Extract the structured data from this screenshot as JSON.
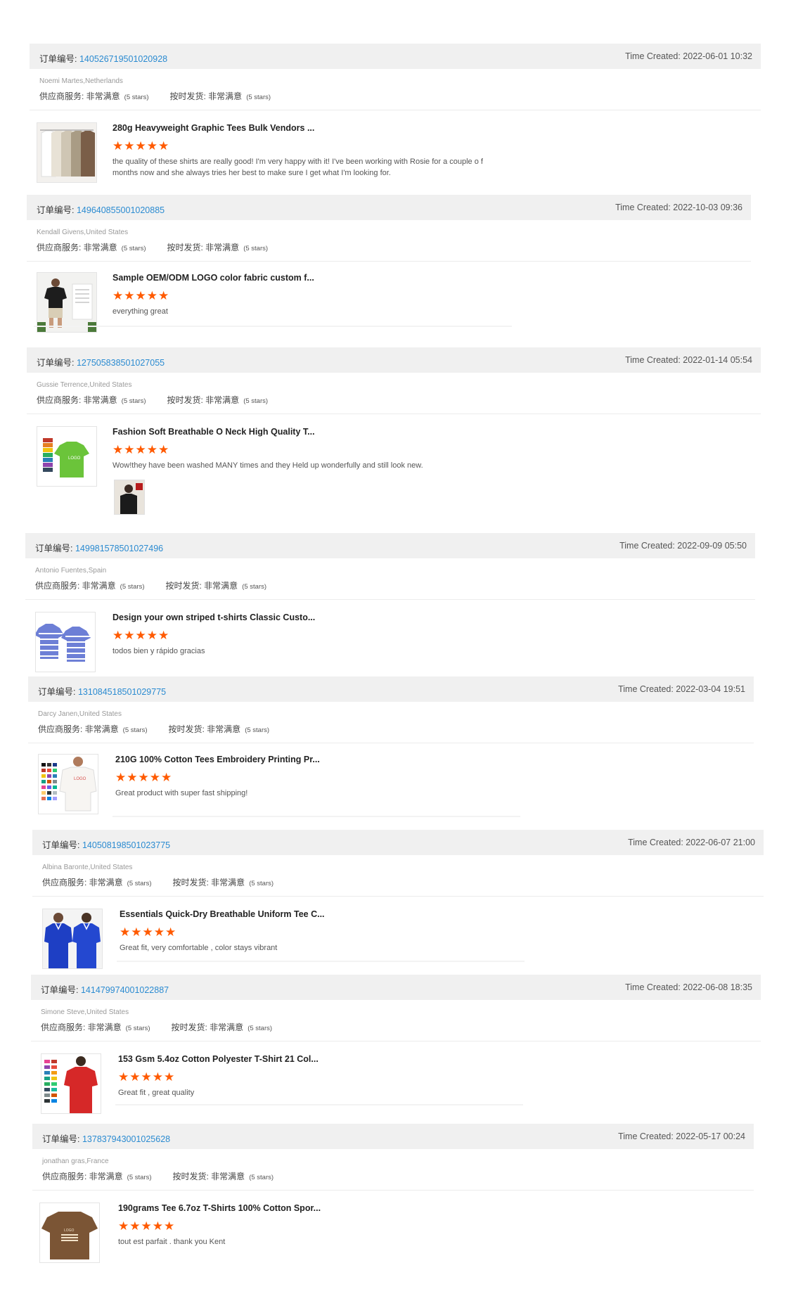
{
  "reviews": [
    {
      "order_label": "订单编号:",
      "order_id": "140526719501020928",
      "time": "Time Created: 2022-06-01 10:32",
      "buyer": "Noemi Martes,Netherlands",
      "supplier_label": "供应商服务: 非常满意",
      "supplier_stars": "(5 stars)",
      "ship_label": "按时发货: 非常满意",
      "ship_stars": "(5 stars)",
      "product": "280g Heavyweight Graphic Tees Bulk Vendors ...",
      "rating": "★★★★★",
      "comment": "the quality of these shirts are really good! I'm very happy with it! I've been working with Rosie for a couple o f months now and she always tries her best to make sure I get what I'm looking for."
    },
    {
      "order_label": "订单编号:",
      "order_id": "149640855001020885",
      "time": "Time Created: 2022-10-03 09:36",
      "buyer": "Kendall Givens,United States",
      "supplier_label": "供应商服务: 非常满意",
      "supplier_stars": "(5 stars)",
      "ship_label": "按时发货: 非常满意",
      "ship_stars": "(5 stars)",
      "product": "Sample OEM/ODM LOGO color fabric custom f...",
      "rating": "★★★★★",
      "comment": "everything great"
    },
    {
      "order_label": "订单编号:",
      "order_id": "127505838501027055",
      "time": "Time Created: 2022-01-14 05:54",
      "buyer": "Gussie Terrence,United States",
      "supplier_label": "供应商服务: 非常满意",
      "supplier_stars": "(5 stars)",
      "ship_label": "按时发货: 非常满意",
      "ship_stars": "(5 stars)",
      "product": "Fashion Soft Breathable O Neck High Quality T...",
      "rating": "★★★★★",
      "comment": "Wow!they have been washed MANY times and they Held up wonderfully and still look new."
    },
    {
      "order_label": "订单编号:",
      "order_id": "149981578501027496",
      "time": "Time Created: 2022-09-09 05:50",
      "buyer": "Antonio Fuentes,Spain",
      "supplier_label": "供应商服务: 非常满意",
      "supplier_stars": "(5 stars)",
      "ship_label": "按时发货: 非常满意",
      "ship_stars": "(5 stars)",
      "product": "Design your own striped t-shirts Classic Custo...",
      "rating": "★★★★★",
      "comment": "todos bien y rápido gracias"
    },
    {
      "order_label": "订单编号:",
      "order_id": "131084518501029775",
      "time": "Time Created: 2022-03-04 19:51",
      "buyer": "Darcy Janen,United States",
      "supplier_label": "供应商服务: 非常满意",
      "supplier_stars": "(5 stars)",
      "ship_label": "按时发货: 非常满意",
      "ship_stars": "(5 stars)",
      "product": "210G 100% Cotton Tees Embroidery Printing Pr...",
      "rating": "★★★★★",
      "comment": "Great product with super fast shipping!"
    },
    {
      "order_label": "订单编号:",
      "order_id": "140508198501023775",
      "time": "Time Created: 2022-06-07 21:00",
      "buyer": "Albina Baronte,United States",
      "supplier_label": "供应商服务: 非常满意",
      "supplier_stars": "(5 stars)",
      "ship_label": "按时发货: 非常满意",
      "ship_stars": "(5 stars)",
      "product": "Essentials Quick-Dry Breathable Uniform Tee C...",
      "rating": "★★★★★",
      "comment": "Great fit, very comfortable , color stays vibrant"
    },
    {
      "order_label": "订单编号:",
      "order_id": "141479974001022887",
      "time": "Time Created: 2022-06-08 18:35",
      "buyer": "Simone Steve,United States",
      "supplier_label": "供应商服务: 非常满意",
      "supplier_stars": "(5 stars)",
      "ship_label": "按时发货: 非常满意",
      "ship_stars": "(5 stars)",
      "product": "153 Gsm 5.4oz Cotton Polyester T-Shirt 21 Col...",
      "rating": "★★★★★",
      "comment": "Great fit , great quality"
    },
    {
      "order_label": "订单编号:",
      "order_id": "137837943001025628",
      "time": "Time Created: 2022-05-17 00:24",
      "buyer": "jonathan gras,France",
      "supplier_label": "供应商服务: 非常满意",
      "supplier_stars": "(5 stars)",
      "ship_label": "按时发货: 非常满意",
      "ship_stars": "(5 stars)",
      "product": "190grams Tee 6.7oz T-Shirts 100% Cotton Spor...",
      "rating": "★★★★★",
      "comment": "tout est parfait . thank you Kent"
    }
  ],
  "thumb_labels": {
    "logo": "LOGO"
  }
}
